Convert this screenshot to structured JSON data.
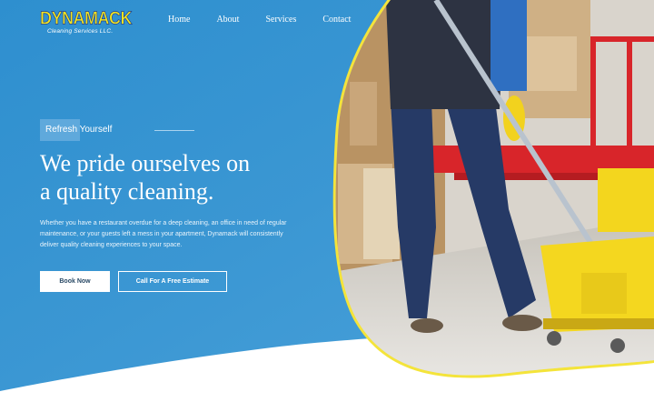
{
  "brand": {
    "logo_text": "DYNAMACK",
    "logo_tagline": "Cleaning Services LLC."
  },
  "nav": {
    "items": [
      "Home",
      "About",
      "Services",
      "Contact"
    ]
  },
  "hero": {
    "eyebrow": "Refresh Yourself",
    "headline_line1": "We pride ourselves on",
    "headline_line2": "a quality cleaning.",
    "body": "Whether you have a restaurant overdue for a deep cleaning, an office in need of regular maintenance, or your guests left a mess in your apartment, Dynamack will consistently deliver quality cleaning experiences to your space.",
    "primary_button": "Book Now",
    "secondary_button": "Call For A Free Estimate",
    "image_subject": "cleaner-mopping-warehouse-photo"
  },
  "colors": {
    "hero_blue": "#3b97d3",
    "hero_blue_light": "#58aadf",
    "accent_yellow": "#f4e43a",
    "logo_yellow": "#f2e51f",
    "button_text": "#2a4a66"
  },
  "icons": {
    "bucket": "mop-bucket-icon",
    "mop": "mop-icon"
  }
}
